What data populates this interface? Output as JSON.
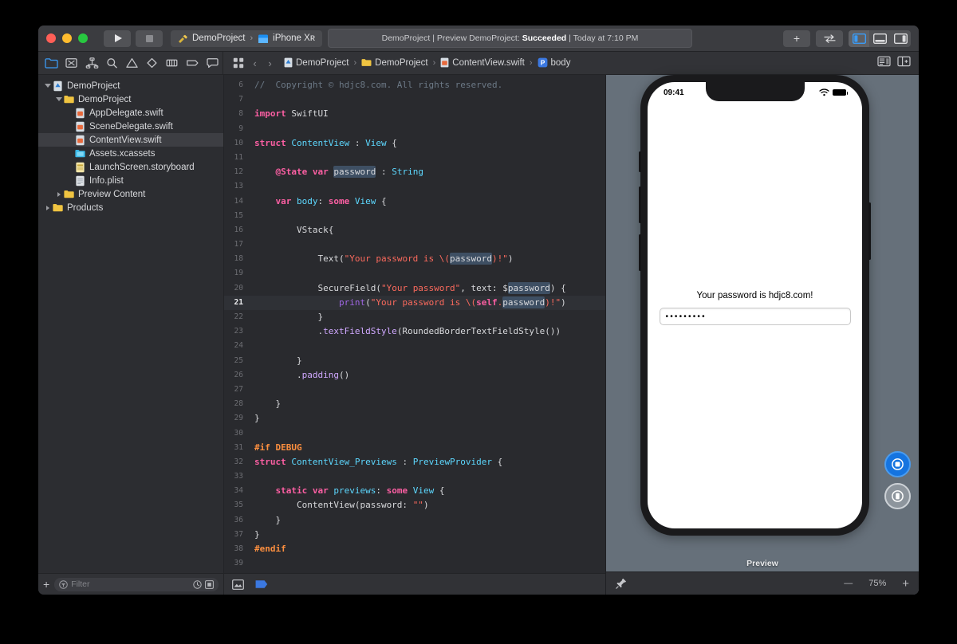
{
  "titlebar": {
    "run_icon": "play-icon",
    "stop_icon": "stop-icon",
    "scheme_project": "DemoProject",
    "scheme_separator": "›",
    "scheme_device": "iPhone Xʀ",
    "status_prefix": "DemoProject | Preview DemoProject:",
    "status_result": "Succeeded",
    "status_time": "| Today at 7:10 PM",
    "add_button": "+",
    "swap_icon": "swap-arrows-icon",
    "panel_left": "left-panel-toggle-icon",
    "panel_bottom": "bottom-panel-toggle-icon",
    "panel_right": "right-panel-toggle-icon"
  },
  "navigator_toolbar": {
    "items": [
      {
        "name": "project-navigator-icon",
        "selected": true
      },
      {
        "name": "source-control-navigator-icon",
        "selected": false
      },
      {
        "name": "symbol-navigator-icon",
        "selected": false
      },
      {
        "name": "find-navigator-icon",
        "selected": false
      },
      {
        "name": "issue-navigator-icon",
        "selected": false
      },
      {
        "name": "test-navigator-icon",
        "selected": false
      },
      {
        "name": "debug-navigator-icon",
        "selected": false
      },
      {
        "name": "breakpoint-navigator-icon",
        "selected": false
      },
      {
        "name": "report-navigator-icon",
        "selected": false
      }
    ]
  },
  "jumpbar": {
    "related_items_icon": "related-items-icon",
    "back_arrow": "‹",
    "forward_arrow": "›",
    "crumbs": [
      {
        "label": "DemoProject",
        "icon": "project-file-icon"
      },
      {
        "label": "DemoProject",
        "icon": "folder-icon"
      },
      {
        "label": "ContentView.swift",
        "icon": "swift-file-icon"
      },
      {
        "label": "body",
        "icon": "property-icon"
      }
    ],
    "separator": "›",
    "editor_options_icon": "editor-options-icon",
    "assistant_editor_icon": "assistant-editor-icon"
  },
  "navigator": {
    "tree": [
      {
        "label": "DemoProject",
        "depth": 0,
        "icon": "project-file-icon",
        "twisty": "open",
        "selected": false
      },
      {
        "label": "DemoProject",
        "depth": 1,
        "icon": "folder-icon",
        "twisty": "open",
        "selected": false
      },
      {
        "label": "AppDelegate.swift",
        "depth": 2,
        "icon": "swift-file-icon",
        "twisty": "none",
        "selected": false
      },
      {
        "label": "SceneDelegate.swift",
        "depth": 2,
        "icon": "swift-file-icon",
        "twisty": "none",
        "selected": false
      },
      {
        "label": "ContentView.swift",
        "depth": 2,
        "icon": "swift-file-icon",
        "twisty": "none",
        "selected": true
      },
      {
        "label": "Assets.xcassets",
        "depth": 2,
        "icon": "assets-icon",
        "twisty": "none",
        "selected": false
      },
      {
        "label": "LaunchScreen.storyboard",
        "depth": 2,
        "icon": "storyboard-icon",
        "twisty": "none",
        "selected": false
      },
      {
        "label": "Info.plist",
        "depth": 2,
        "icon": "plist-icon",
        "twisty": "none",
        "selected": false
      },
      {
        "label": "Preview Content",
        "depth": 1,
        "icon": "folder-icon",
        "twisty": "closed",
        "selected": false
      },
      {
        "label": "Products",
        "depth": 0,
        "icon": "folder-icon",
        "twisty": "closed",
        "selected": false
      }
    ],
    "filter": {
      "add_button": "+",
      "placeholder": "Filter",
      "recent_icon": "clock-icon",
      "scope_icon": "nested-square-icon"
    }
  },
  "editor": {
    "current_line": 21,
    "lines": [
      {
        "n": 6,
        "tokens": [
          {
            "t": "comment",
            "v": "//  Copyright © hdjc8.com. All rights reserved."
          }
        ]
      },
      {
        "n": 7,
        "tokens": []
      },
      {
        "n": 8,
        "tokens": [
          {
            "t": "kw",
            "v": "import"
          },
          {
            "t": "plain",
            "v": " SwiftUI"
          }
        ]
      },
      {
        "n": 9,
        "tokens": []
      },
      {
        "n": 10,
        "tokens": [
          {
            "t": "kw",
            "v": "struct"
          },
          {
            "t": "plain",
            "v": " "
          },
          {
            "t": "type",
            "v": "ContentView"
          },
          {
            "t": "plain",
            "v": " : "
          },
          {
            "t": "type",
            "v": "View"
          },
          {
            "t": "plain",
            "v": " {"
          }
        ]
      },
      {
        "n": 11,
        "tokens": []
      },
      {
        "n": 12,
        "tokens": [
          {
            "t": "plain",
            "v": "    "
          },
          {
            "t": "kw",
            "v": "@State"
          },
          {
            "t": "plain",
            "v": " "
          },
          {
            "t": "kw",
            "v": "var"
          },
          {
            "t": "plain",
            "v": " "
          },
          {
            "t": "hl",
            "v": "password"
          },
          {
            "t": "plain",
            "v": " : "
          },
          {
            "t": "type",
            "v": "String"
          }
        ]
      },
      {
        "n": 13,
        "tokens": []
      },
      {
        "n": 14,
        "tokens": [
          {
            "t": "plain",
            "v": "    "
          },
          {
            "t": "kw",
            "v": "var"
          },
          {
            "t": "plain",
            "v": " "
          },
          {
            "t": "type",
            "v": "body"
          },
          {
            "t": "plain",
            "v": ": "
          },
          {
            "t": "kw",
            "v": "some"
          },
          {
            "t": "plain",
            "v": " "
          },
          {
            "t": "type",
            "v": "View"
          },
          {
            "t": "plain",
            "v": " {"
          }
        ]
      },
      {
        "n": 15,
        "tokens": []
      },
      {
        "n": 16,
        "tokens": [
          {
            "t": "plain",
            "v": "        VStack{"
          }
        ]
      },
      {
        "n": 17,
        "tokens": []
      },
      {
        "n": 18,
        "tokens": [
          {
            "t": "plain",
            "v": "            Text("
          },
          {
            "t": "str",
            "v": "\"Your password is \\("
          },
          {
            "t": "hl",
            "v": "password"
          },
          {
            "t": "str",
            "v": ")!\""
          },
          {
            "t": "plain",
            "v": ")"
          }
        ]
      },
      {
        "n": 19,
        "tokens": []
      },
      {
        "n": 20,
        "tokens": [
          {
            "t": "plain",
            "v": "            SecureField("
          },
          {
            "t": "str",
            "v": "\"Your password\""
          },
          {
            "t": "plain",
            "v": ", text: $"
          },
          {
            "t": "hl",
            "v": "password"
          },
          {
            "t": "plain",
            "v": ") {"
          }
        ]
      },
      {
        "n": 21,
        "tokens": [
          {
            "t": "plain",
            "v": "                "
          },
          {
            "t": "func",
            "v": "print"
          },
          {
            "t": "plain",
            "v": "("
          },
          {
            "t": "str",
            "v": "\"Your password is \\("
          },
          {
            "t": "kw",
            "v": "self"
          },
          {
            "t": "str",
            "v": "."
          },
          {
            "t": "hl",
            "v": "password"
          },
          {
            "t": "str",
            "v": ")!\""
          },
          {
            "t": "plain",
            "v": ")"
          }
        ]
      },
      {
        "n": 22,
        "tokens": [
          {
            "t": "plain",
            "v": "            }"
          }
        ]
      },
      {
        "n": 23,
        "tokens": [
          {
            "t": "plain",
            "v": "            ."
          },
          {
            "t": "prop",
            "v": "textFieldStyle"
          },
          {
            "t": "plain",
            "v": "(RoundedBorderTextFieldStyle())"
          }
        ]
      },
      {
        "n": 24,
        "tokens": []
      },
      {
        "n": 25,
        "tokens": [
          {
            "t": "plain",
            "v": "        }"
          }
        ]
      },
      {
        "n": 26,
        "tokens": [
          {
            "t": "plain",
            "v": "        ."
          },
          {
            "t": "prop",
            "v": "padding"
          },
          {
            "t": "plain",
            "v": "()"
          }
        ]
      },
      {
        "n": 27,
        "tokens": []
      },
      {
        "n": 28,
        "tokens": [
          {
            "t": "plain",
            "v": "    }"
          }
        ]
      },
      {
        "n": 29,
        "tokens": [
          {
            "t": "plain",
            "v": "}"
          }
        ]
      },
      {
        "n": 30,
        "tokens": []
      },
      {
        "n": 31,
        "tokens": [
          {
            "t": "prepro",
            "v": "#if DEBUG"
          }
        ]
      },
      {
        "n": 32,
        "tokens": [
          {
            "t": "kw",
            "v": "struct"
          },
          {
            "t": "plain",
            "v": " "
          },
          {
            "t": "type",
            "v": "ContentView_Previews"
          },
          {
            "t": "plain",
            "v": " : "
          },
          {
            "t": "type",
            "v": "PreviewProvider"
          },
          {
            "t": "plain",
            "v": " {"
          }
        ]
      },
      {
        "n": 33,
        "tokens": []
      },
      {
        "n": 34,
        "tokens": [
          {
            "t": "plain",
            "v": "    "
          },
          {
            "t": "kw",
            "v": "static"
          },
          {
            "t": "plain",
            "v": " "
          },
          {
            "t": "kw",
            "v": "var"
          },
          {
            "t": "plain",
            "v": " "
          },
          {
            "t": "type",
            "v": "previews"
          },
          {
            "t": "plain",
            "v": ": "
          },
          {
            "t": "kw",
            "v": "some"
          },
          {
            "t": "plain",
            "v": " "
          },
          {
            "t": "type",
            "v": "View"
          },
          {
            "t": "plain",
            "v": " {"
          }
        ]
      },
      {
        "n": 35,
        "tokens": [
          {
            "t": "plain",
            "v": "        ContentView(password: "
          },
          {
            "t": "str",
            "v": "\"\""
          },
          {
            "t": "plain",
            "v": ")"
          }
        ]
      },
      {
        "n": 36,
        "tokens": [
          {
            "t": "plain",
            "v": "    }"
          }
        ]
      },
      {
        "n": 37,
        "tokens": [
          {
            "t": "plain",
            "v": "}"
          }
        ]
      },
      {
        "n": 38,
        "tokens": [
          {
            "t": "prepro",
            "v": "#endif"
          }
        ]
      },
      {
        "n": 39,
        "tokens": []
      }
    ],
    "bottombar": {
      "minimap_icon": "minimap-icon",
      "flag_icon": "blue-flag-icon"
    }
  },
  "preview": {
    "device_name": "iPhone Xʀ",
    "status_time": "09:41",
    "wifi_icon": "wifi-icon",
    "battery_icon": "battery-icon",
    "app_text": "Your password is hdjc8.com!",
    "secure_field_value": "•••••••••",
    "label": "Preview",
    "live_preview_icon": "live-preview-icon",
    "device_preview_icon": "device-preview-icon",
    "pin_icon": "pin-icon",
    "zoom_out": "—",
    "zoom_level": "75%",
    "zoom_in": "+"
  },
  "colors": {
    "accent": "#1574e0",
    "keyword": "#fc5fa3",
    "type": "#5dd8ff",
    "string": "#fc6a5d",
    "comment": "#6c7986",
    "preprocessor": "#fd8f3f",
    "selection": "#3e4f63"
  }
}
